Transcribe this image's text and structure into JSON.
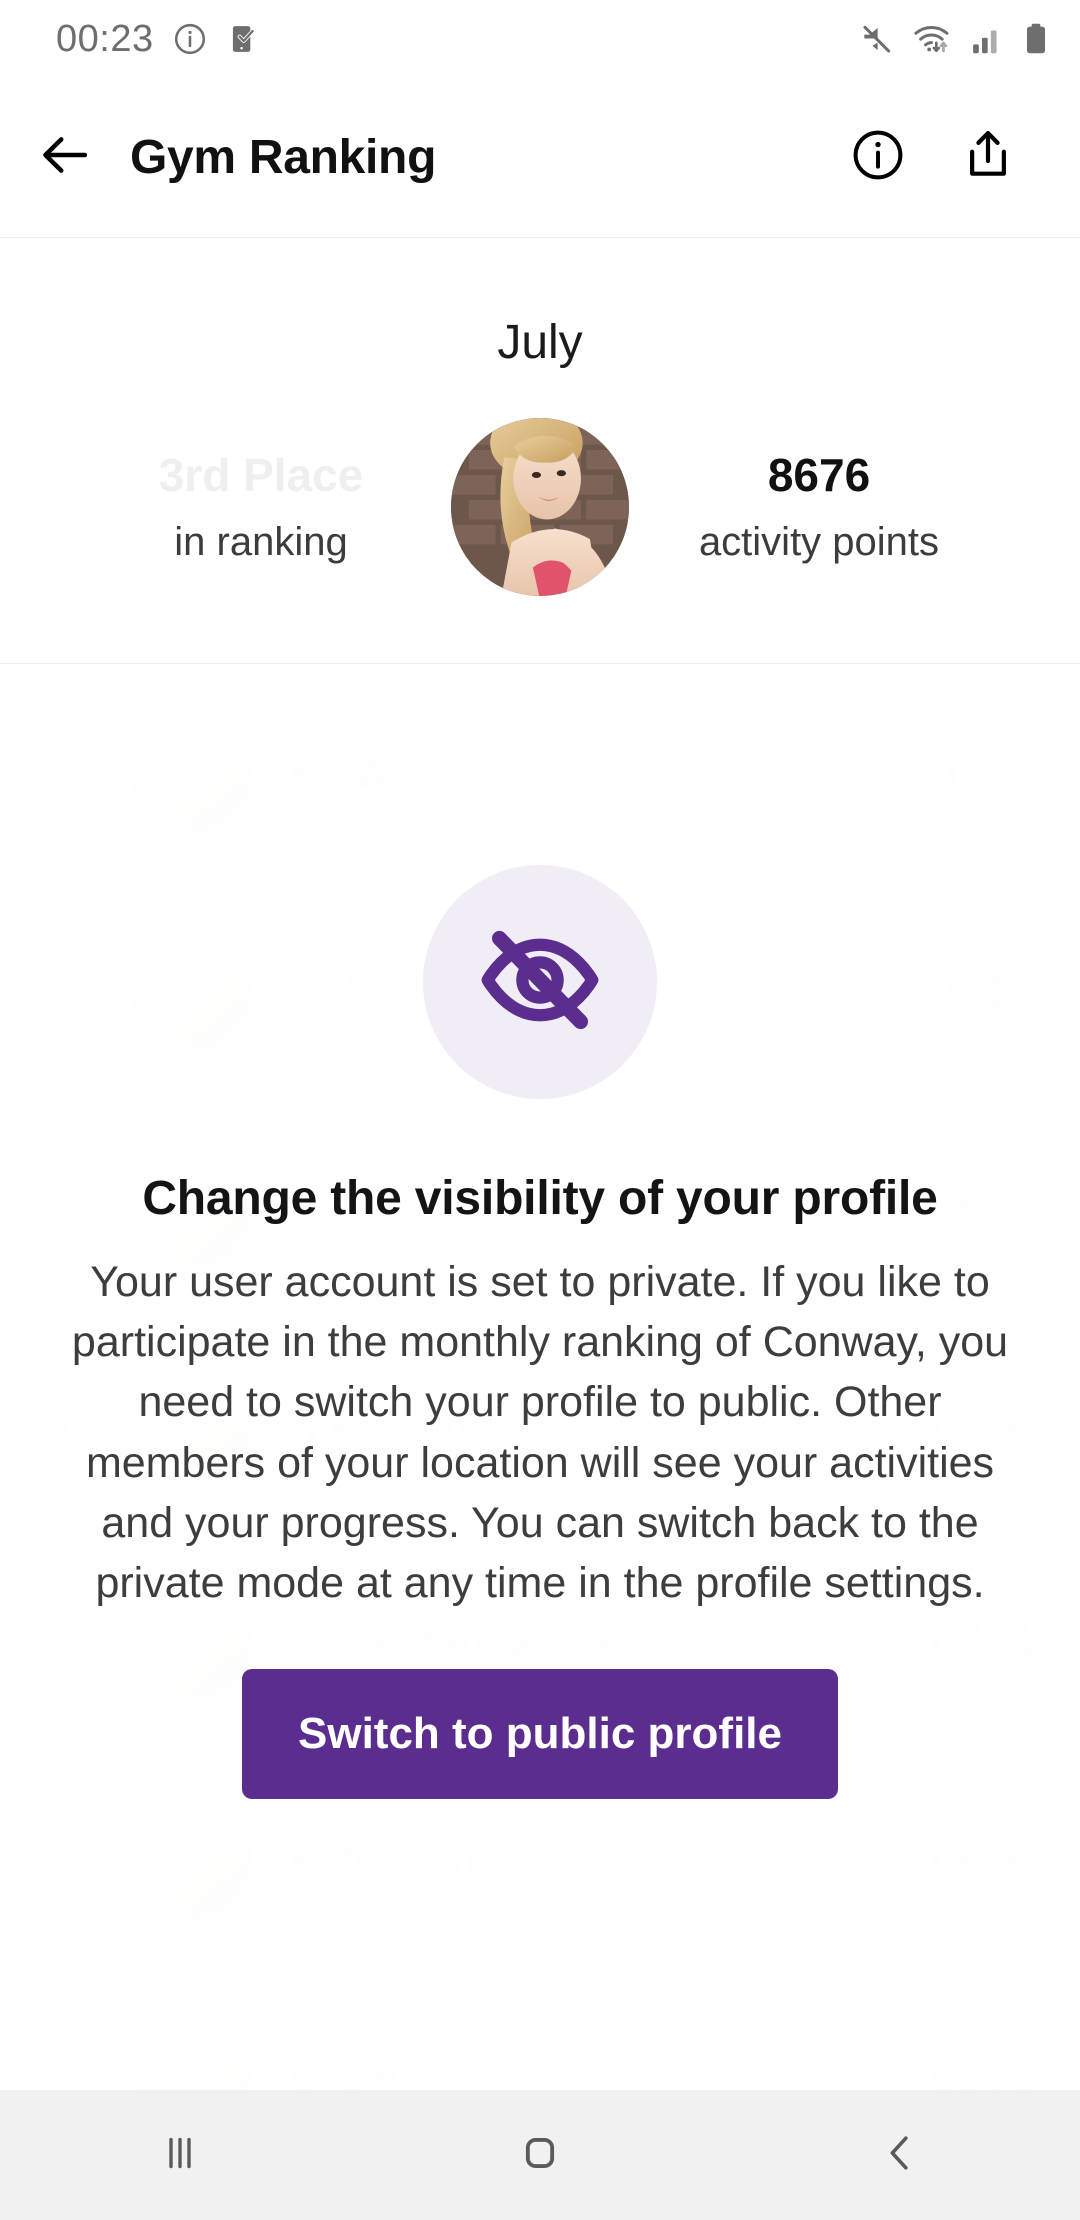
{
  "status_bar": {
    "time": "00:23",
    "left_icons": [
      "info-circle-icon",
      "phone-check-icon"
    ],
    "right_icons": [
      "mute-icon",
      "wifi-icon",
      "signal-icon",
      "battery-icon"
    ]
  },
  "app_bar": {
    "back_label": "back-arrow-icon",
    "title": "Gym Ranking",
    "info_label": "info-circle-icon",
    "share_label": "share-icon"
  },
  "summary": {
    "month": "July",
    "rank_value": "3rd Place",
    "rank_label": "in ranking",
    "points_value": "8676",
    "points_label": "activity points"
  },
  "leaderboard": {
    "rows": [
      {
        "rank": "1",
        "name": "Kit Weirmeir",
        "points": "9223"
      },
      {
        "rank": "2",
        "name": "Liel Schmidt",
        "points": "9017"
      },
      {
        "rank": "3",
        "name": "",
        "points": "8676"
      },
      {
        "rank": "4",
        "name": "Nik Hendricks",
        "points": "6806"
      },
      {
        "rank": "5",
        "name": "Vincent Aegerbaum",
        "points": "6774"
      },
      {
        "rank": "6",
        "name": "Kate Bishop",
        "points": "6606"
      },
      {
        "rank": "7",
        "name": "Ella A",
        "points": "6505"
      }
    ]
  },
  "overlay": {
    "icon": "eye-off-icon",
    "title": "Change the visibility of your profile",
    "body": "Your user account is set to private. If you like to participate in the monthly ranking of Conway, you need to switch your profile to public. Other members of your location will see your activities and your progress. You can switch back to the private mode at any time in the profile settings.",
    "button_label": "Switch to public profile"
  },
  "nav_bar": {
    "recents_label": "recents-icon",
    "home_label": "home-icon",
    "back_label": "back-chevron-icon"
  },
  "colors": {
    "accent_purple": "#5B2D8E",
    "icon_tint_light": "#F1EDF6",
    "status_icon": "#6E6E6E",
    "nav_bar_bg": "#F1F1F1"
  }
}
